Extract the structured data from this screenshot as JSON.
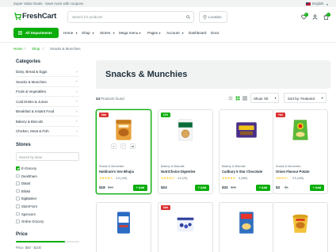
{
  "topbar": {
    "promo": "Super Value Deals - Save more with coupons",
    "language": "English"
  },
  "header": {
    "logo": "FreshCart",
    "search_placeholder": "Search for products",
    "location_label": "Location",
    "wishlist_count": "5",
    "cart_count": "1"
  },
  "nav": {
    "departments_label": "All Departments",
    "items": [
      "Home",
      "Shop",
      "Stores",
      "Mega menu",
      "Pages",
      "Account",
      "Dashboard",
      "Docs"
    ]
  },
  "breadcrumb": [
    "Home",
    "Shop",
    "Snacks & Munchies"
  ],
  "sidebar": {
    "categories_title": "Categories",
    "categories": [
      "Dairy, Bread & Eggs",
      "Snacks & Munchies",
      "Fruits & Vegetables",
      "Cold Drinks & Juices",
      "Breakfast & Instant Food",
      "Bakery & Biscuits",
      "Chicken, Meat & Fish"
    ],
    "stores_title": "Stores",
    "stores_search_placeholder": "Search by store",
    "stores": [
      {
        "name": "E-Grocery",
        "checked": true
      },
      {
        "name": "DealShare",
        "checked": false
      },
      {
        "name": "DMart",
        "checked": false
      },
      {
        "name": "Blinkit",
        "checked": false
      },
      {
        "name": "BigBasket",
        "checked": false
      },
      {
        "name": "StoreFront",
        "checked": false
      },
      {
        "name": "Spencers",
        "checked": false
      },
      {
        "name": "Online Grocery",
        "checked": false
      }
    ],
    "price_title": "Price",
    "price_range": "Price: $50 - $100"
  },
  "main": {
    "banner_title": "Snacks & Munchies",
    "products_found_count": "24",
    "products_found_text": "Products found",
    "show_label": "Show: 50",
    "sort_label": "Sort by: Featured"
  },
  "products": [
    {
      "tag": "Sale",
      "tag_type": "sale",
      "category": "Snack & Munchies",
      "name": "Haldiram's Sev Bhujia",
      "stars": "★★★★½",
      "rating": "4.5 (149)",
      "price": "$18",
      "old_price": "$24",
      "add_label": "+ Add",
      "image": "bhujia-pack"
    },
    {
      "tag": "14%",
      "tag_type": "pct",
      "category": "Bakery & Biscuits",
      "name": "NutriChoice Digestive",
      "stars": "★★★★½",
      "rating": "4.5 (25)",
      "price": "$24",
      "old_price": "",
      "add_label": "+ Add",
      "image": "digestive-pack"
    },
    {
      "tag": "",
      "tag_type": "",
      "category": "Bakery & Biscuits",
      "name": "Cadbury 5 Star Chocolate",
      "stars": "★★★★★",
      "rating": "5 (469)",
      "price": "$32",
      "old_price": "$35",
      "add_label": "+ Add",
      "image": "chocolate-pack"
    },
    {
      "tag": "Hot",
      "tag_type": "sale",
      "category": "Snack & Munchies",
      "name": "Onion Flavour Potato",
      "stars": "★★★½☆",
      "rating": "3.5 (456)",
      "price": "$3",
      "old_price": "$5",
      "add_label": "+ Add",
      "image": "chips-pack"
    },
    {
      "tag": "",
      "tag_type": "",
      "image": "salt-pack"
    },
    {
      "tag": "Sale",
      "tag_type": "sale",
      "image": "berries-tub"
    },
    {
      "tag": "",
      "tag_type": "",
      "image": "cereal-box"
    },
    {
      "tag": "",
      "tag_type": "",
      "image": "noodles-cup"
    }
  ],
  "colors": {
    "accent": "#0aad0a",
    "sale": "#db3030",
    "text": "#21313c",
    "muted": "#5c6c75"
  }
}
